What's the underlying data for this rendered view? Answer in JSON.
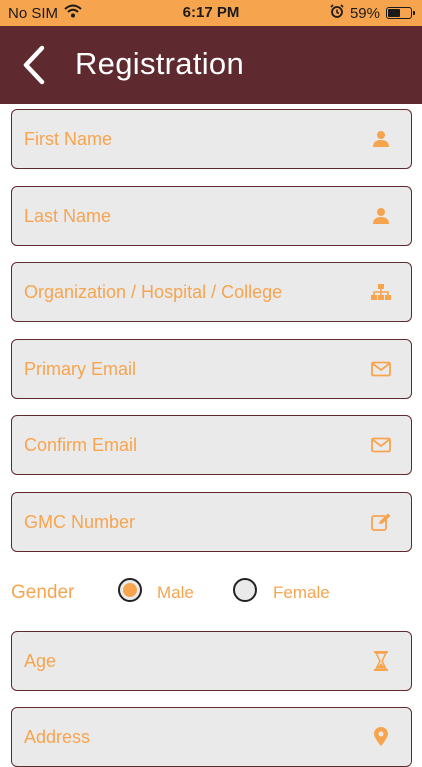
{
  "status_bar": {
    "carrier": "No SIM",
    "time": "6:17 PM",
    "battery_percent": "59%",
    "battery_level": 0.59,
    "icons": [
      "wifi-icon",
      "alarm-icon",
      "battery-icon"
    ]
  },
  "nav": {
    "title": "Registration",
    "back_icon": "chevron-left-icon"
  },
  "fields": {
    "first_name": {
      "placeholder": "First Name",
      "icon": "user-icon"
    },
    "last_name": {
      "placeholder": "Last Name",
      "icon": "user-icon"
    },
    "organization": {
      "placeholder": "Organization / Hospital / College",
      "icon": "sitemap-icon"
    },
    "primary_email": {
      "placeholder": "Primary Email",
      "icon": "envelope-icon"
    },
    "confirm_email": {
      "placeholder": "Confirm Email",
      "icon": "envelope-icon"
    },
    "gmc_number": {
      "placeholder": "GMC Number",
      "icon": "edit-icon"
    },
    "age": {
      "placeholder": "Age",
      "icon": "hourglass-icon"
    },
    "address": {
      "placeholder": "Address",
      "icon": "map-pin-icon"
    }
  },
  "gender": {
    "label": "Gender",
    "options": [
      "Male",
      "Female"
    ],
    "selected": "Male"
  },
  "colors": {
    "status_bar": "#f7a44f",
    "nav_bar": "#5e2a2f",
    "accent": "#f7a44f",
    "field_bg": "#ebeaea",
    "field_border": "#5e2a2f"
  }
}
